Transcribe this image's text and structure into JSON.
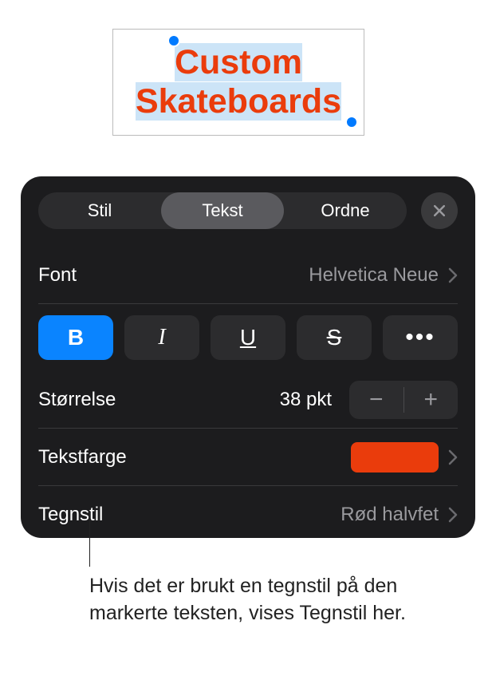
{
  "textbox": {
    "line1": "Custom",
    "line2": "Skateboards"
  },
  "panel": {
    "tabs": {
      "stil": "Stil",
      "tekst": "Tekst",
      "ordne": "Ordne"
    },
    "font": {
      "label": "Font",
      "value": "Helvetica Neue"
    },
    "style_buttons": {
      "bold": "B",
      "italic": "I",
      "underline": "U",
      "strike": "S"
    },
    "size": {
      "label": "Størrelse",
      "value": "38 pkt"
    },
    "textcolor": {
      "label": "Tekstfarge",
      "color": "#ea3c0c"
    },
    "charstyle": {
      "label": "Tegnstil",
      "value": "Rød halvfet"
    }
  },
  "callout": {
    "text": "Hvis det er brukt en tegnstil på den markerte teksten, vises Tegnstil her."
  }
}
